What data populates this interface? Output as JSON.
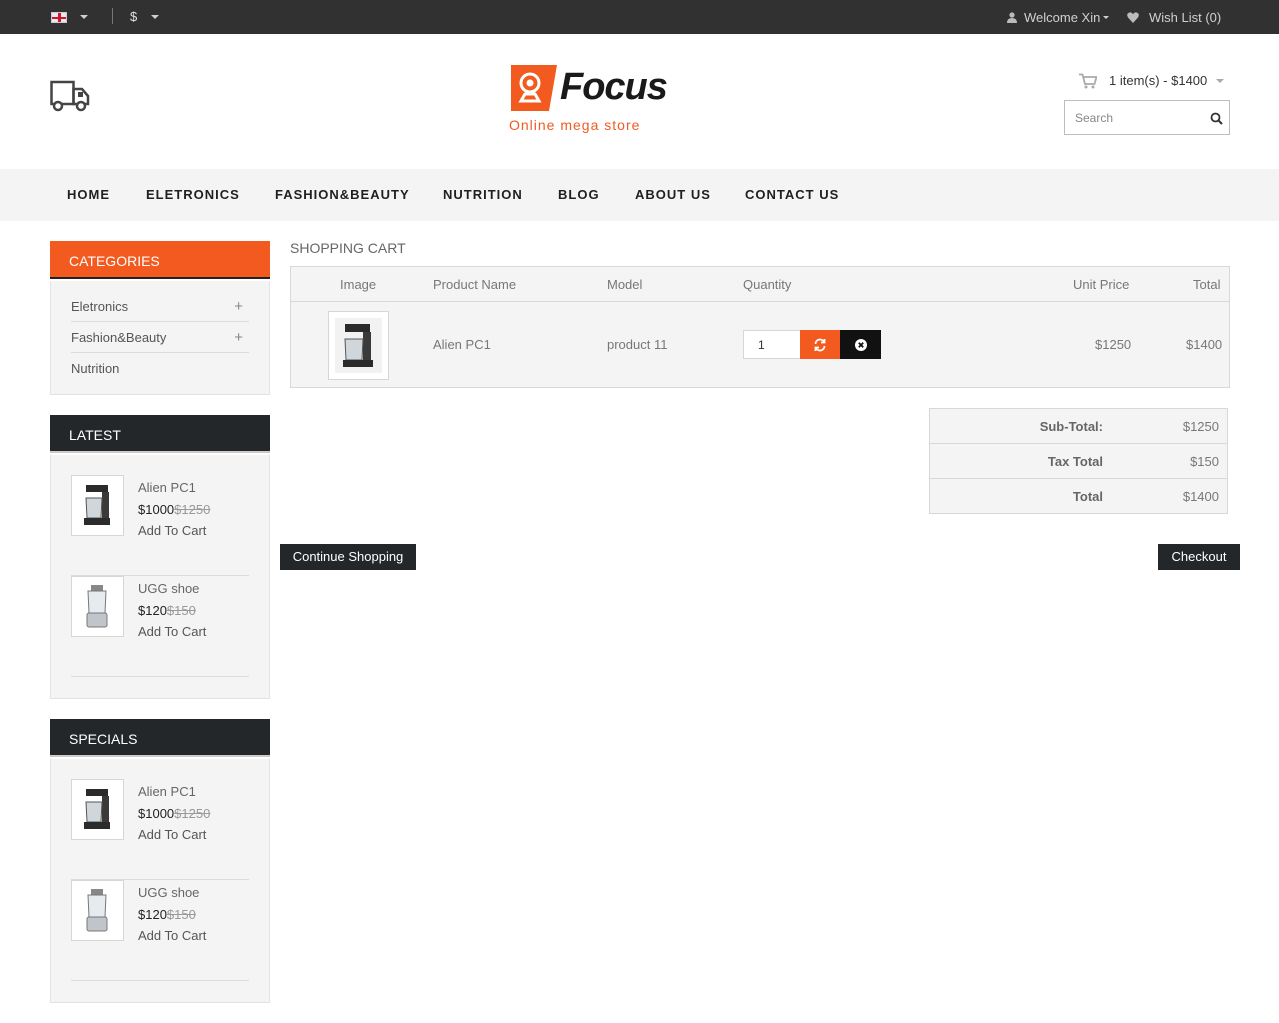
{
  "topbar": {
    "currency": "$",
    "welcome": "Welcome Xin",
    "wishlist": "Wish List (0)"
  },
  "header": {
    "logo_text": "Focus",
    "tagline": "Online mega store",
    "cart_summary": "1 item(s) - $1400",
    "search_placeholder": "Search"
  },
  "nav": [
    "HOME",
    "ELETRONICS",
    "FASHION&BEAUTY",
    "NUTRITION",
    "BLOG",
    "ABOUT US",
    "CONTACT US"
  ],
  "sidebar": {
    "categories_title": "CATEGORIES",
    "categories": [
      "Eletronics",
      "Fashion&Beauty",
      "Nutrition"
    ],
    "latest_title": "LATEST",
    "latest": [
      {
        "name": "Alien PC1",
        "price": "$1000",
        "old_price": "$1250",
        "action": "Add To Cart"
      },
      {
        "name": "UGG shoe",
        "price": "$120",
        "old_price": "$150",
        "action": "Add To Cart"
      }
    ],
    "specials_title": "SPECIALS",
    "specials": [
      {
        "name": "Alien PC1",
        "price": "$1000",
        "old_price": "$1250",
        "action": "Add To Cart"
      },
      {
        "name": "UGG shoe",
        "price": "$120",
        "old_price": "$150",
        "action": "Add To Cart"
      }
    ]
  },
  "cart": {
    "title": "SHOPPING CART",
    "columns": [
      "Image",
      "Product Name",
      "Model",
      "Quantity",
      "Unit Price",
      "Total"
    ],
    "item": {
      "name": "Alien PC1",
      "model": "product 11",
      "quantity": "1",
      "unit_price": "$1250",
      "total": "$1400"
    },
    "totals": [
      {
        "label": "Sub-Total:",
        "value": "$1250"
      },
      {
        "label": "Tax Total",
        "value": "$150"
      },
      {
        "label": "Total",
        "value": "$1400"
      }
    ],
    "continue_label": "Continue Shopping",
    "checkout_label": "Checkout"
  },
  "colors": {
    "accent": "#f25a20",
    "dark": "#23272a",
    "topbar": "#313131"
  }
}
